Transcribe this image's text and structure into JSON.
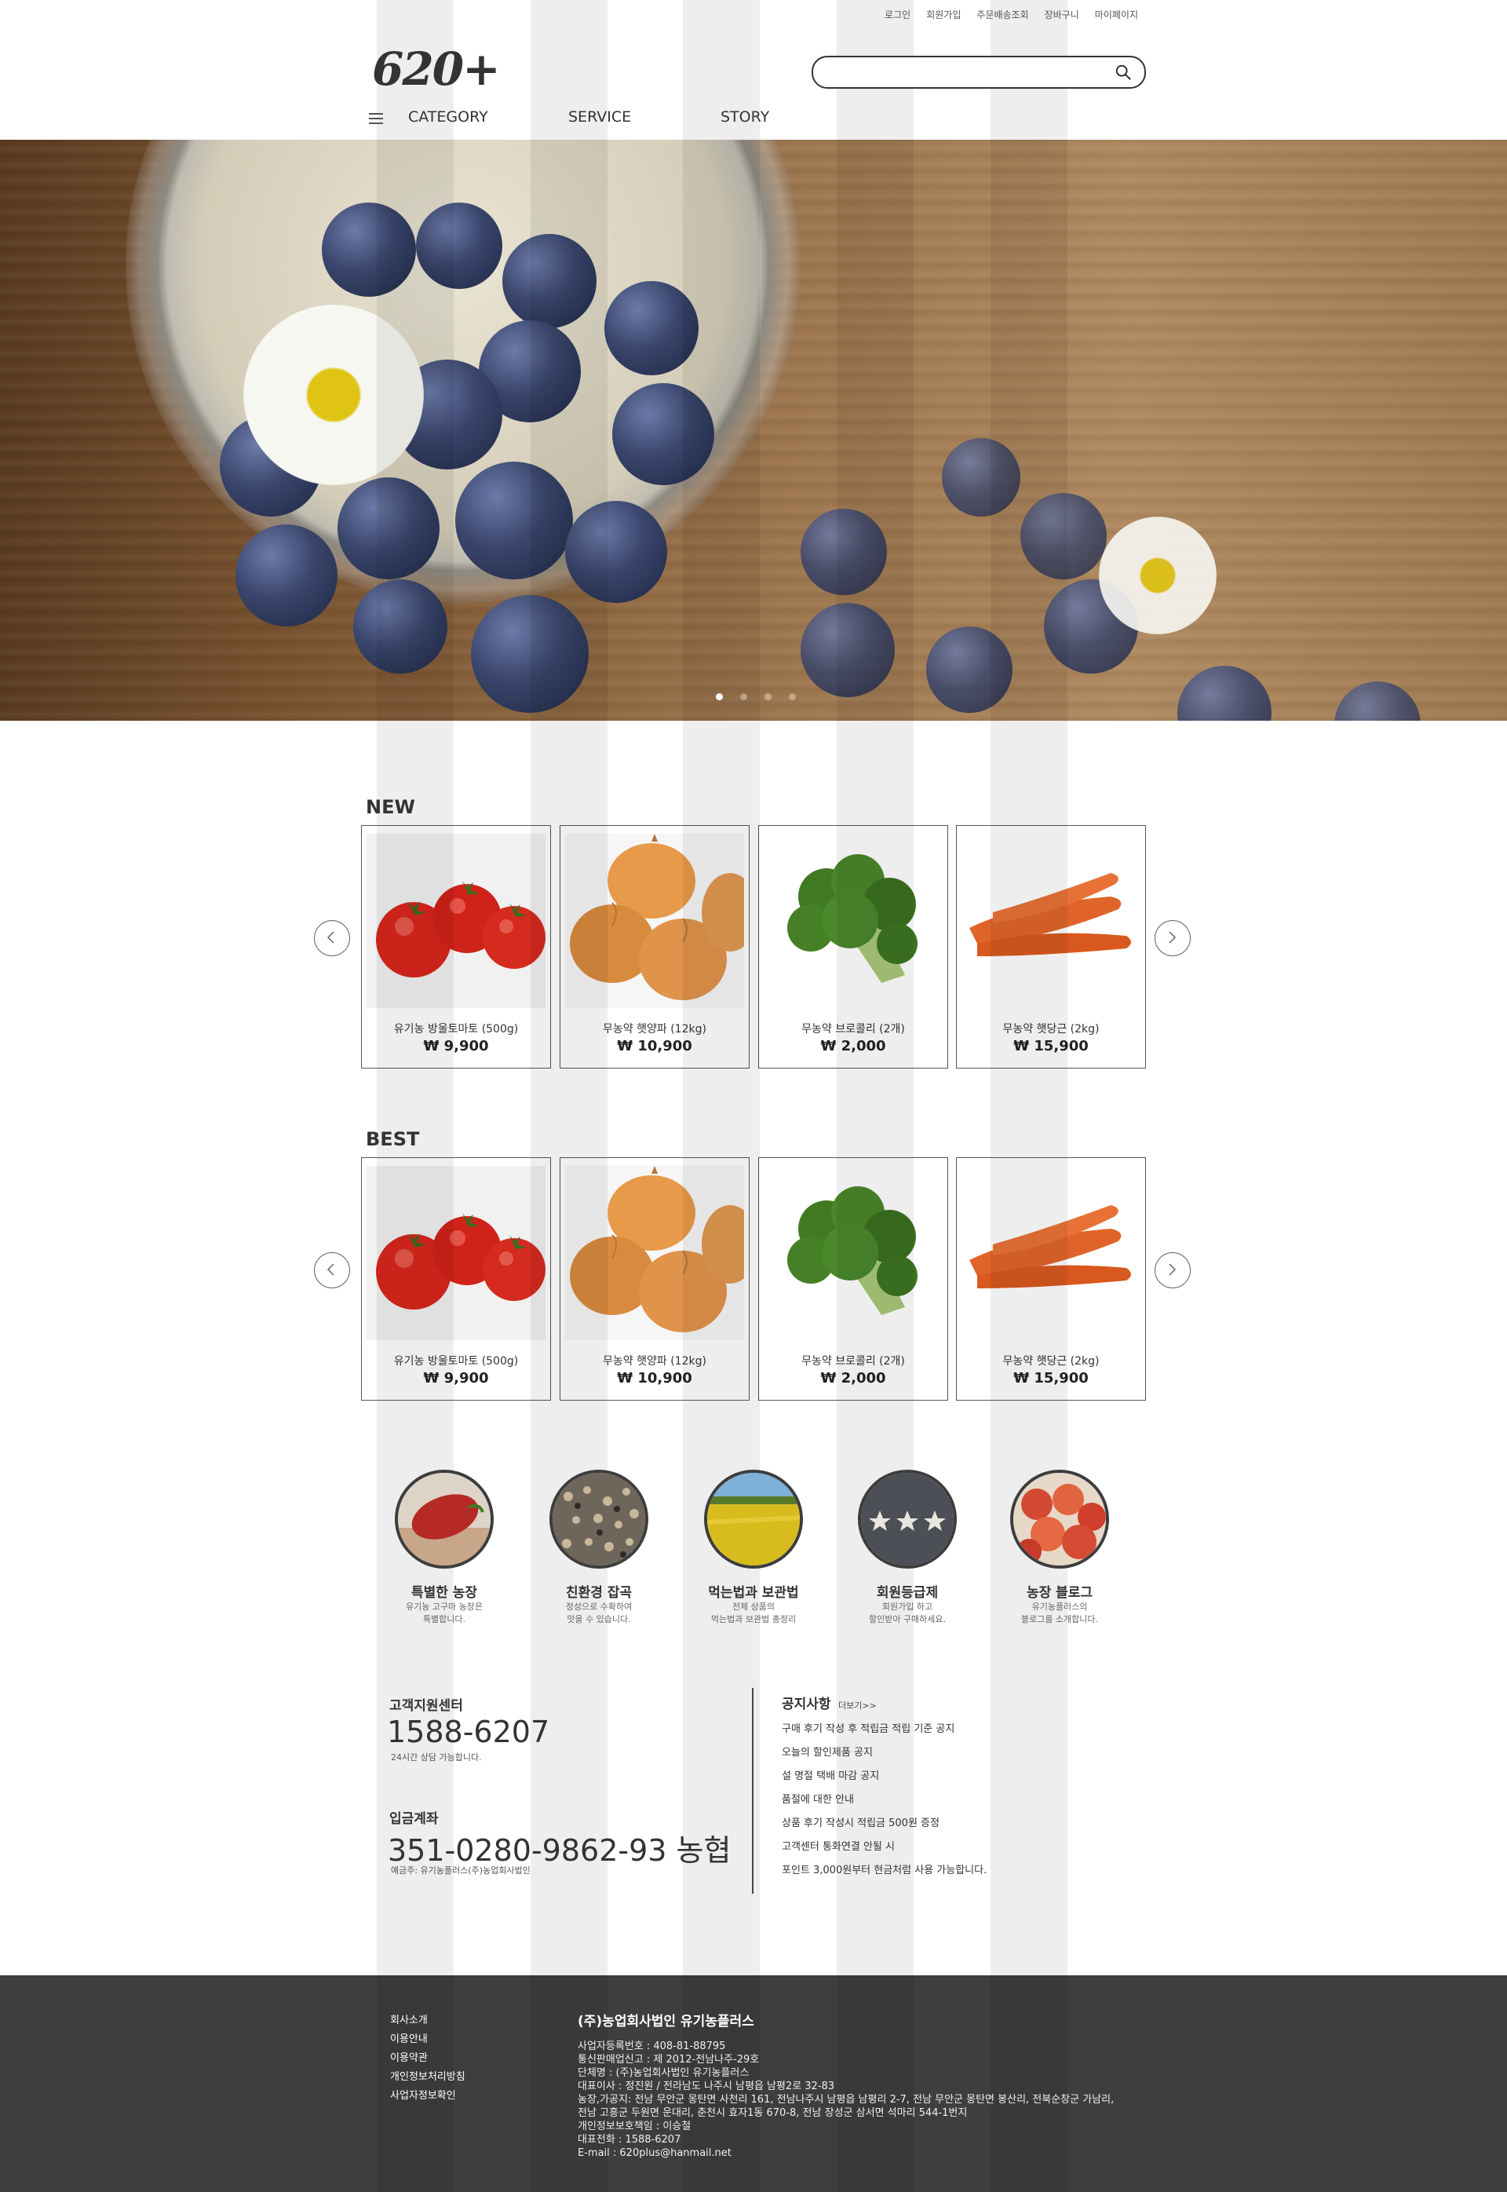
{
  "header": {
    "top_links": [
      "로그인",
      "회원가입",
      "주문배송조회",
      "장바구니",
      "마이페이지"
    ],
    "logo": "620+",
    "search_placeholder": "",
    "nav": [
      "CATEGORY",
      "SERVICE",
      "STORY"
    ]
  },
  "hero": {
    "slides_total": 4,
    "active_slide": 1
  },
  "new_section": {
    "title": "NEW",
    "products": [
      {
        "name": "유기농 방울토마토 (500g)",
        "price": "₩ 9,900",
        "image": "tomato"
      },
      {
        "name": "무농약 햇양파 (12kg)",
        "price": "₩ 10,900",
        "image": "onion"
      },
      {
        "name": "무농약 브로콜리 (2개)",
        "price": "₩ 2,000",
        "image": "broccoli"
      },
      {
        "name": "무농약 햇당근 (2kg)",
        "price": "₩ 15,900",
        "image": "carrot"
      }
    ]
  },
  "best_section": {
    "title": "BEST",
    "products": [
      {
        "name": "유기농 방울토마토 (500g)",
        "price": "₩ 9,900",
        "image": "tomato"
      },
      {
        "name": "무농약 햇양파 (12kg)",
        "price": "₩ 10,900",
        "image": "onion"
      },
      {
        "name": "무농약 브로콜리 (2개)",
        "price": "₩ 2,000",
        "image": "broccoli"
      },
      {
        "name": "무농약 햇당근 (2kg)",
        "price": "₩ 15,900",
        "image": "carrot"
      }
    ]
  },
  "features": [
    {
      "title": "특별한 농장",
      "desc": "유기농 고구마 농장은\n특별합니다."
    },
    {
      "title": "친환경 잡곡",
      "desc": "정성으로 수확하여\n맛을 수 있습니다."
    },
    {
      "title": "먹는법과 보관법",
      "desc": "전체 상품의\n먹는법과 보관법 총정리"
    },
    {
      "title": "회원등급제",
      "desc": "회원가입 하고\n할인받아 구매하세요."
    },
    {
      "title": "농장 블로그",
      "desc": "유기농플러스의\n블로그를 소개합니다."
    }
  ],
  "support": {
    "title": "고객지원센터",
    "phone": "1588-6207",
    "hours": "24시간 상담 가능합니다.",
    "bank_title": "입금계좌",
    "account": "351-0280-9862-93 농협",
    "holder": "예금주: 유기농플러스(주)농업회사법인"
  },
  "notice": {
    "title": "공지사항",
    "more": "더보기>>",
    "items": [
      "구매 후기 작성 후 적립금 적립 기준 공지",
      "오늘의 할인제품 공지",
      "설 명절 택배 마감 공지",
      "품절에 대한 안내",
      "상품 후기 작성시 적립금 500원 증정",
      "고객센터 통화연결 안될 시",
      "포인트 3,000원부터 현금처럼 사용 가능합니다."
    ]
  },
  "footer": {
    "links": [
      "회사소개",
      "이용안내",
      "이용약관",
      "개인정보처리방침",
      "사업자정보확인"
    ],
    "company": "(주)농업회사법인 유기농플러스",
    "info": [
      "사업자등록번호 : 408-81-88795",
      "통신판매업신고 : 제 2012-전남나주-29호",
      "단체명 : (주)농업회사법인 유기농플러스",
      "대표이사 : 정진원 / 전라남도 나주시 남평읍 남평2로 32-83",
      "농장,가공지: 전남 무안군 몽탄면 사천리 161, 전남나주시 남평읍 남평리 2-7, 전남 무안군 몽탄면 봉산리, 전북순창군 가남리,",
      "전남 고흥군 두원면 운대리, 춘천시 효자1동 670-8, 전남 장성군 삼서면 석마리 544-1번지",
      "개인정보보호책임 : 이승철",
      "대표전화 : 1588-6207",
      "E-mail : 620plus@hanmail.net"
    ]
  },
  "colors": {
    "text_dark": "#333333",
    "footer_bg": "#3e3e3e",
    "stripe": "#efefef"
  }
}
